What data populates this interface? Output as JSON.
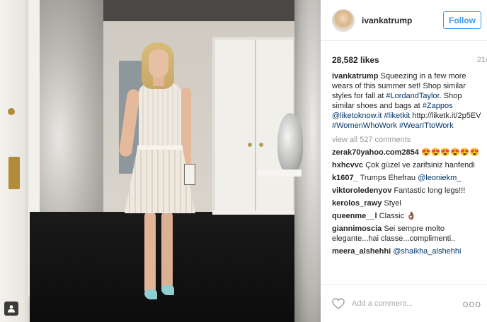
{
  "header": {
    "username": "ivankatrump",
    "follow_label": "Follow"
  },
  "meta": {
    "likes": "28,582 likes",
    "age": "21w"
  },
  "caption": {
    "username": "ivankatrump",
    "text_1": "Squeezing in a few more wears of this summer set! Shop similar styles for fall at ",
    "tag_1": "#LordandTaylor",
    "text_2": ". Shop similar shoes and bags at ",
    "tag_2": "#Zappos",
    "text_3": " ",
    "tag_3": "@liketoknow.it",
    "text_4": " ",
    "tag_4": "#liketkit",
    "text_5": " http://liketk.it/2p5EV ",
    "tag_5": "#WomenWhoWork",
    "text_6": " ",
    "tag_6": "#WearITtoWork"
  },
  "view_all": "view all 527 comments",
  "comments": [
    {
      "user": "zerak70yahoo.com2854",
      "text": "😍😍😍😍😍😍"
    },
    {
      "user": "hxhcvvc",
      "text": "Çok güzel ve zarifsiniz hanfendi"
    },
    {
      "user": "k1607_",
      "text": "Trumps Ehefrau ",
      "mention": "@leoniekm_"
    },
    {
      "user": "viktoroledenyov",
      "text": "Fantastic long legs!!!"
    },
    {
      "user": "kerolos_rawy",
      "text": "Styel"
    },
    {
      "user": "queenme__l",
      "text": "Classic 👌🏾"
    },
    {
      "user": "giannimoscia",
      "text": "Sei sempre molto elegante...hai classe...complimenti.."
    },
    {
      "user": "meera_alshehhi",
      "text": "",
      "mention": "@shaikha_alshehhi"
    }
  ],
  "footer": {
    "add_comment_placeholder": "Add a comment...",
    "more": "ooo"
  },
  "icons": {
    "tag": "person-tag-icon",
    "heart": "heart-icon",
    "more": "more-options-icon"
  },
  "colors": {
    "accent": "#3897f0",
    "hashtag": "#003569",
    "muted": "#999999"
  }
}
